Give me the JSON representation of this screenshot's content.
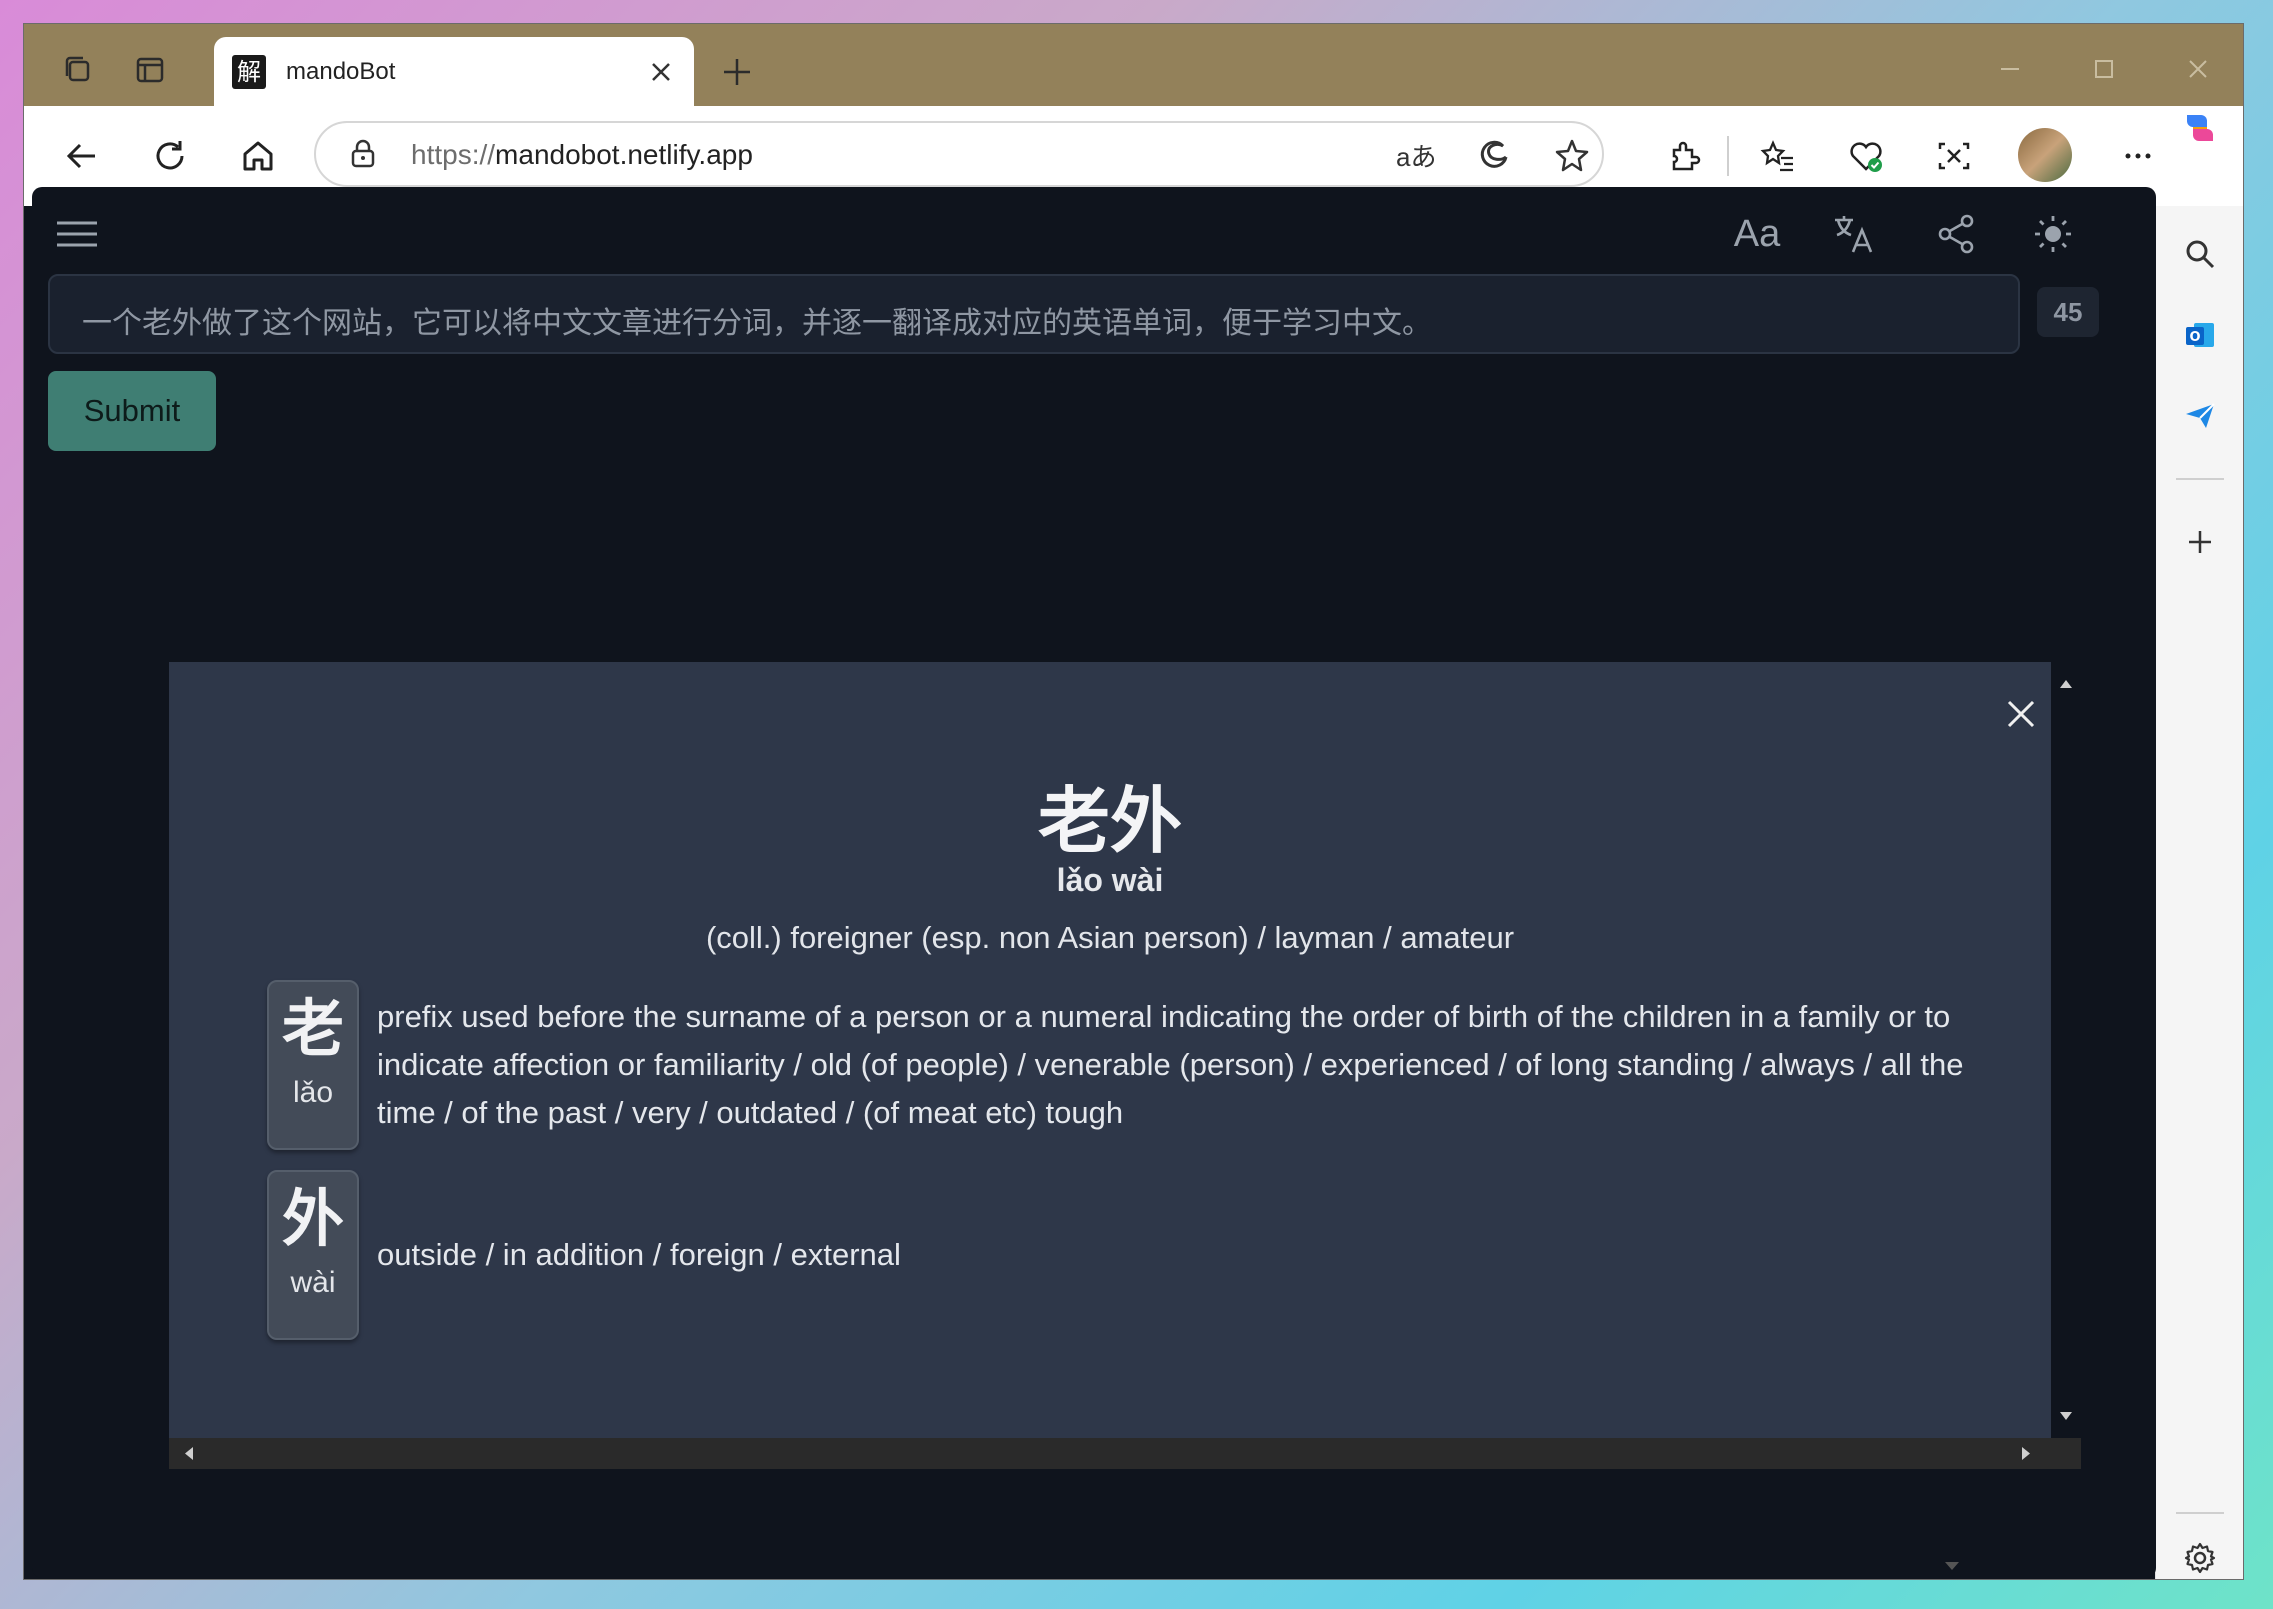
{
  "browser": {
    "tab_title": "mandoBot",
    "favicon_char": "解",
    "url_scheme": "https://",
    "url_host": "mandobot.netlify.app",
    "read_aloud_label": "aあ"
  },
  "app": {
    "input_text": "一个老外做了这个网站，它可以将中文文章进行分词，并逐一翻译成对应的英语单词，便于学习中文。",
    "char_count": "45",
    "submit_label": "Submit",
    "font_label": "Aa"
  },
  "modal": {
    "word": "老外",
    "pinyin": "lǎo wài",
    "definition": "(coll.) foreigner (esp. non Asian person) / layman / amateur",
    "chars": [
      {
        "hanzi": "老",
        "pinyin": "lǎo",
        "definition": "prefix used before the surname of a person or a numeral indicating the order of birth of the children in a family or to indicate affection or familiarity / old (of people) / venerable (person) / experienced / of long standing / always / all the time / of the past / very / outdated / (of meat etc) tough"
      },
      {
        "hanzi": "外",
        "pinyin": "wài",
        "definition": "outside / in addition / foreign / external"
      }
    ]
  }
}
